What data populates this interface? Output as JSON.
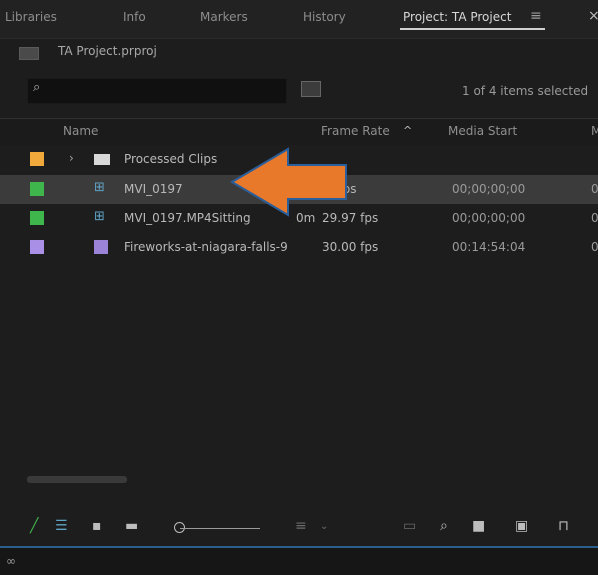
{
  "tabs": [
    {
      "label": "Libraries"
    },
    {
      "label": "Info"
    },
    {
      "label": "Markers"
    },
    {
      "label": "History"
    },
    {
      "label": "Project: TA Project"
    }
  ],
  "panel_menu_icon": "≡",
  "close_icon": "×",
  "project": {
    "filename": "TA Project.prproj"
  },
  "search": {
    "placeholder": "",
    "icon": "⌕"
  },
  "selection_status": "1 of 4 items selected",
  "columns": {
    "name": "Name",
    "frame_rate": "Frame Rate",
    "media_start": "Media Start",
    "more": "M"
  },
  "sort_arrow": "^",
  "items": [
    {
      "name": "Processed Clips",
      "type": "bin",
      "swatch": "#f2a93b",
      "frame_rate": "",
      "media_start": "",
      "extra": ""
    },
    {
      "name": "MVI_0197",
      "type": "sequence",
      "swatch": "#3fb64b",
      "frame_rate": "7 fps",
      "media_start": "00;00;00;00",
      "extra": "0"
    },
    {
      "name": "MVI_0197.MP4Sitting",
      "name_tail": "0m",
      "type": "sequence",
      "swatch": "#3fb64b",
      "frame_rate": "29.97 fps",
      "media_start": "00;00;00;00",
      "extra": "0"
    },
    {
      "name": "Fireworks-at-niagara-falls-9",
      "type": "clip",
      "swatch": "#a98fe6",
      "frame_rate": "30.00 fps",
      "media_start": "00:14:54:04",
      "extra": "0"
    }
  ],
  "colors": {
    "accent_pen": "#3fb64b",
    "arrow": "#e8782a",
    "arrow_outline": "#2a5f9b",
    "statusbar_line": "#2c5f8c"
  }
}
